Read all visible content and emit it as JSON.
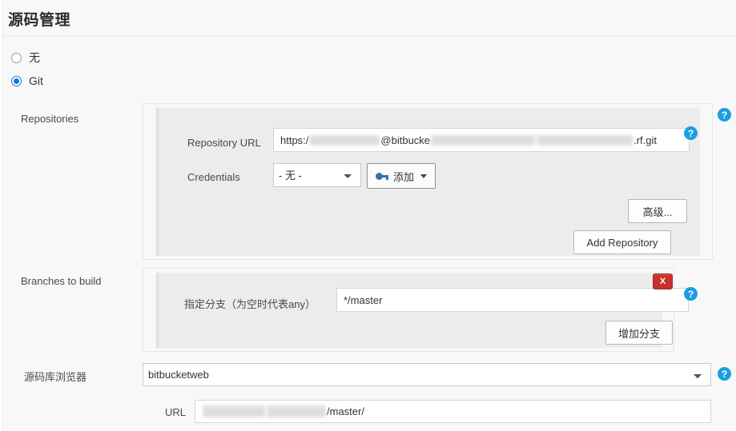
{
  "section": {
    "title": "源码管理"
  },
  "scm_options": [
    {
      "label": "无",
      "selected": false
    },
    {
      "label": "Git",
      "selected": true
    }
  ],
  "repositories": {
    "row_label": "Repositories",
    "repository_url": {
      "label": "Repository URL",
      "value_visible_parts": [
        "https:/",
        "@bitbucke",
        ".rf.git"
      ],
      "value": "https:/[redacted]@bitbucke[redacted].rf.git"
    },
    "credentials": {
      "label": "Credentials",
      "selected": "- 无 -",
      "options": [
        "- 无 -"
      ]
    },
    "add_credentials_button": {
      "label": "添加",
      "icon": "key-icon",
      "caret": "chevron-down-icon"
    },
    "advanced_button": "高级...",
    "add_repository_button": "Add Repository"
  },
  "branches": {
    "row_label": "Branches to build",
    "branch_spec": {
      "label": "指定分支（为空时代表any）",
      "value": "*/master"
    },
    "delete_button": "X",
    "add_branch_button": "增加分支"
  },
  "repo_browser": {
    "row_label": "源码库浏览器",
    "selected": "bitbucketweb",
    "options": [
      "bitbucketweb"
    ],
    "url": {
      "label": "URL",
      "value_visible_parts": [
        "/master/"
      ],
      "value": "[redacted]/master/"
    }
  },
  "help_icons": {
    "glyph": "?",
    "count": 5
  },
  "colors": {
    "page_bg": "#f8f8f8",
    "panel_bg": "#ececec",
    "accent_radio": "#1675d1",
    "help_blue": "#1a9fe0",
    "delete_red": "#c9302c",
    "key_blue": "#3b6fb0",
    "border": "#e6e6e6"
  }
}
